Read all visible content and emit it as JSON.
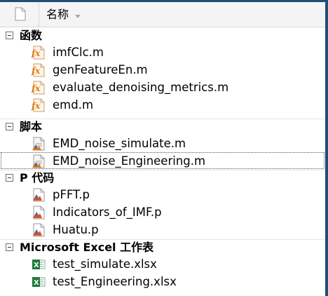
{
  "header": {
    "name_column": "名称"
  },
  "groups": [
    {
      "label": "函数",
      "items": [
        {
          "name": "imfClc.m",
          "icon": "function-file-icon"
        },
        {
          "name": "genFeatureEn.m",
          "icon": "function-file-icon"
        },
        {
          "name": "evaluate_denoising_metrics.m",
          "icon": "function-file-icon"
        },
        {
          "name": "emd.m",
          "icon": "function-file-icon"
        }
      ]
    },
    {
      "label": "脚本",
      "items": [
        {
          "name": "EMD_noise_simulate.m",
          "icon": "script-file-icon"
        },
        {
          "name": "EMD_noise_Engineering.m",
          "icon": "script-file-icon",
          "focused": true
        }
      ]
    },
    {
      "label": "P 代码",
      "items": [
        {
          "name": "pFFT.p",
          "icon": "p-code-file-icon"
        },
        {
          "name": "Indicators_of_IMF.p",
          "icon": "p-code-file-icon"
        },
        {
          "name": "Huatu.p",
          "icon": "p-code-file-icon"
        }
      ]
    },
    {
      "label": "Microsoft Excel 工作表",
      "items": [
        {
          "name": "test_simulate.xlsx",
          "icon": "excel-file-icon"
        },
        {
          "name": "test_Engineering.xlsx",
          "icon": "excel-file-icon"
        }
      ]
    }
  ],
  "colors": {
    "function_icon": "#e07a10",
    "script_icon": "#3a6bc4",
    "excel_icon": "#1e7b3a",
    "title_strip": "#1f4e79"
  }
}
